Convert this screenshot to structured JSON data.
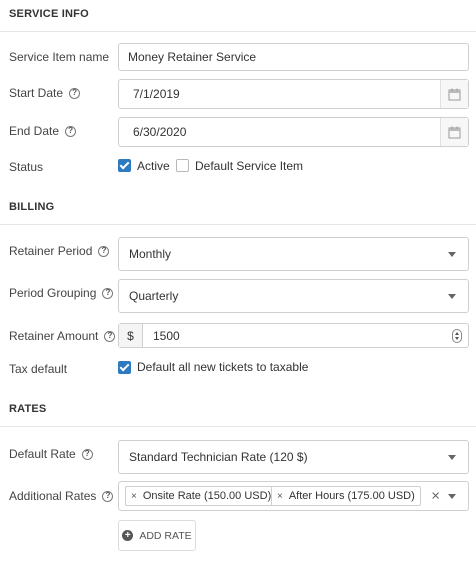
{
  "service_info": {
    "heading": "SERVICE INFO",
    "service_item_name": {
      "label": "Service Item name",
      "value": "Money Retainer Service"
    },
    "start_date": {
      "label": "Start Date",
      "value": "7/1/2019"
    },
    "end_date": {
      "label": "End Date",
      "value": "6/30/2020"
    },
    "status": {
      "label": "Status",
      "active": {
        "label": "Active",
        "checked": true
      },
      "default_service_item": {
        "label": "Default Service Item",
        "checked": false
      }
    }
  },
  "billing": {
    "heading": "BILLING",
    "retainer_period": {
      "label": "Retainer Period",
      "value": "Monthly"
    },
    "period_grouping": {
      "label": "Period Grouping",
      "value": "Quarterly"
    },
    "retainer_amount": {
      "label": "Retainer Amount",
      "currency": "$",
      "value": "1500"
    },
    "tax_default": {
      "label": "Tax default",
      "checkbox_label": "Default all new tickets to taxable",
      "checked": true
    }
  },
  "rates": {
    "heading": "RATES",
    "default_rate": {
      "label": "Default Rate",
      "value": "Standard Technician Rate (120 $)"
    },
    "additional_rates": {
      "label": "Additional Rates",
      "tags": [
        "Onsite Rate (150.00 USD)",
        "After Hours (175.00 USD)"
      ]
    },
    "add_rate_label": "ADD RATE"
  },
  "colors": {
    "accent": "#2d7ac0",
    "border": "#cfcfcf"
  },
  "icons": {
    "help": "question-circle-icon",
    "calendar": "calendar-icon",
    "dropdown": "chevron-down-icon",
    "add": "plus-circle-icon",
    "remove": "close-icon"
  }
}
